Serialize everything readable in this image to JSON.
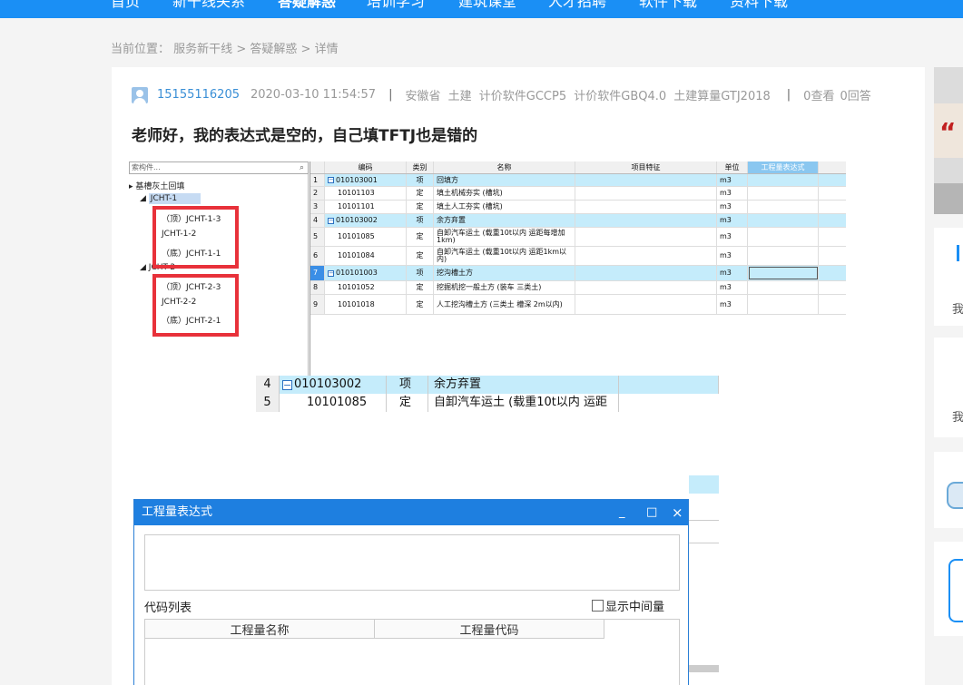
{
  "nav": {
    "items": [
      "首页",
      "新干线关系",
      "答疑解惑",
      "培训学习",
      "建筑课堂",
      "人才招聘",
      "软件下载",
      "资料下载"
    ],
    "active_index": 2
  },
  "breadcrumb": {
    "prefix": "当前位置：",
    "links": [
      "服务新干线",
      "答疑解惑",
      "详情"
    ],
    "sep": ">"
  },
  "post": {
    "user": "15155116205",
    "datetime": "2020-03-10 11:54:57",
    "separator": "|",
    "region": "安徽省",
    "tags": [
      "土建",
      "计价软件GCCP5",
      "计价软件GBQ4.0",
      "土建算量GTJ2018"
    ],
    "views": "0查看",
    "answers": "0回答",
    "title": "老师好，我的表达式是空的，自己填TFTJ也是错的"
  },
  "screenshot": {
    "tree": {
      "search_placeholder": "索构件...",
      "root": "基槽灰土回填",
      "g1": "JCHT-1",
      "g1_items": [
        "（顶）JCHT-1-3",
        "JCHT-1-2",
        "（底）JCHT-1-1"
      ],
      "g2": "JCHT-2",
      "g2_items": [
        "（顶）JCHT-2-3",
        "JCHT-2-2",
        "（底）JCHT-2-1"
      ]
    },
    "table": {
      "headers": [
        "编码",
        "类别",
        "名称",
        "项目特征",
        "单位",
        "工程量表达式"
      ],
      "rows": [
        {
          "n": "1",
          "code": "010103001",
          "type": "项",
          "name": "回填方",
          "unit": "m3",
          "group": true
        },
        {
          "n": "2",
          "code": "10101103",
          "type": "定",
          "name": "填土机械夯实 (槽坑)",
          "unit": "m3",
          "group": false
        },
        {
          "n": "3",
          "code": "10101101",
          "type": "定",
          "name": "填土人工夯实 (槽坑)",
          "unit": "m3",
          "group": false
        },
        {
          "n": "4",
          "code": "010103002",
          "type": "项",
          "name": "余方弃置",
          "unit": "m3",
          "group": true
        },
        {
          "n": "5",
          "code": "10101085",
          "type": "定",
          "name": "自卸汽车运土 (载重10t以内 运距每增加1km)",
          "unit": "m3",
          "group": false
        },
        {
          "n": "6",
          "code": "10101084",
          "type": "定",
          "name": "自卸汽车运土 (载重10t以内 运距1km以内)",
          "unit": "m3",
          "group": false
        },
        {
          "n": "7",
          "code": "010101003",
          "type": "项",
          "name": "挖沟槽土方",
          "unit": "m3",
          "group": true
        },
        {
          "n": "8",
          "code": "10101052",
          "type": "定",
          "name": "挖掘机挖一般土方 (装车 三类土)",
          "unit": "m3",
          "group": false
        },
        {
          "n": "9",
          "code": "10101018",
          "type": "定",
          "name": "人工挖沟槽土方 (三类土 槽深 2m以内)",
          "unit": "m3",
          "group": false
        }
      ]
    },
    "zoom": {
      "n": "4",
      "code": "010103002",
      "type": "项",
      "name": "余方弃置",
      "n2": "5",
      "code2": "10101085",
      "type2": "定",
      "name2": "自卸汽车运土 (载重10t以内 运距"
    },
    "dialog": {
      "title": "工程量表达式",
      "min": "_",
      "max": "□",
      "close": "×",
      "code_list": "代码列表",
      "show_intermediate": "显示中间量",
      "col_name": "工程量名称",
      "col_code": "工程量代码"
    }
  },
  "sidebar": {
    "t1": "我",
    "t2": "我"
  }
}
